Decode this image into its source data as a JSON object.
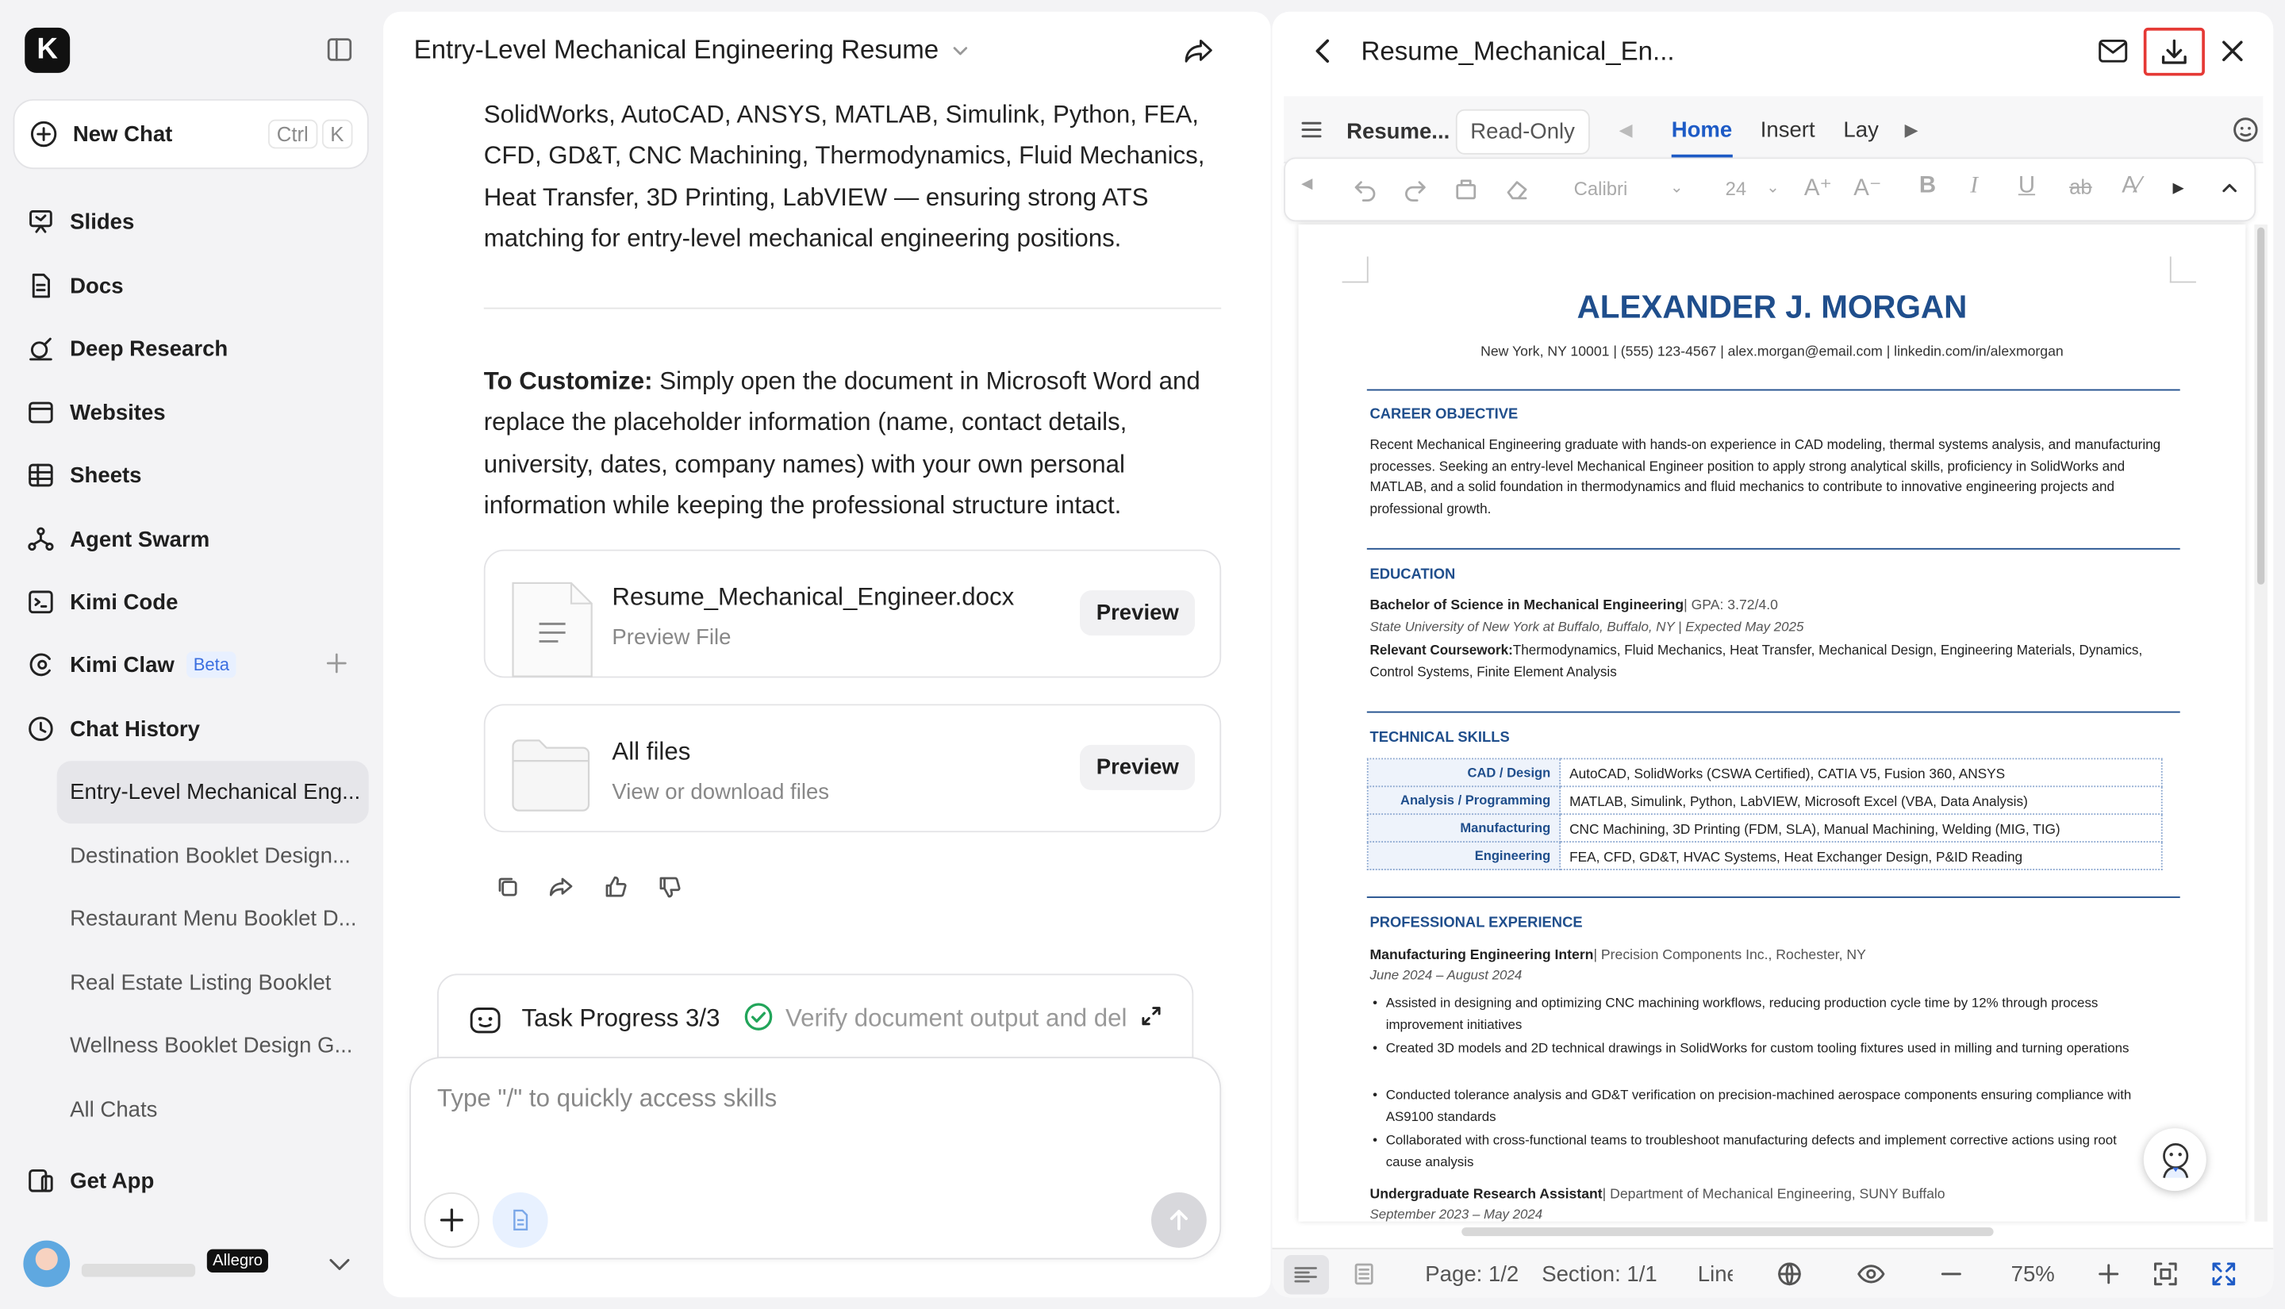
{
  "sidebar": {
    "logo": "K",
    "new_chat": {
      "label": "New Chat",
      "shortcut": [
        "Ctrl",
        "K"
      ]
    },
    "nav": [
      {
        "label": "Slides",
        "icon": "slides-icon"
      },
      {
        "label": "Docs",
        "icon": "docs-icon"
      },
      {
        "label": "Deep Research",
        "icon": "deep-research-icon"
      },
      {
        "label": "Websites",
        "icon": "websites-icon"
      },
      {
        "label": "Sheets",
        "icon": "sheets-icon"
      },
      {
        "label": "Agent Swarm",
        "icon": "agent-swarm-icon"
      },
      {
        "label": "Kimi Code",
        "icon": "kimi-code-icon"
      },
      {
        "label": "Kimi Claw",
        "icon": "kimi-claw-icon",
        "badge": "Beta"
      },
      {
        "label": "Chat History",
        "icon": "clock-icon"
      }
    ],
    "history": [
      "Entry-Level Mechanical Eng...",
      "Destination Booklet Design...",
      "Restaurant Menu Booklet D...",
      "Real Estate Listing Booklet",
      "Wellness Booklet Design G...",
      "All Chats"
    ],
    "get_app": "Get App",
    "user": {
      "tier": "Allegro"
    }
  },
  "chat": {
    "title": "Entry-Level Mechanical Engineering Resume",
    "paragraph1": "SolidWorks, AutoCAD, ANSYS, MATLAB, Simulink, Python, FEA, CFD, GD&T, CNC Machining, Thermodynamics, Fluid Mechanics, Heat Transfer, 3D Printing, LabVIEW — ensuring strong ATS matching for entry-level mechanical engineering positions.",
    "customize_bold": "To Customize:",
    "customize_text": " Simply open the document in Microsoft Word and replace the placeholder information (name, contact details, university, dates, company names) with your own personal information while keeping the professional structure intact.",
    "files": [
      {
        "name": "Resume_Mechanical_Engineer.docx",
        "sub": "Preview File",
        "button": "Preview"
      },
      {
        "name": "All files",
        "sub": "View or download files",
        "button": "Preview"
      }
    ],
    "task": {
      "label": "Task Progress 3/3",
      "status": "Verify document output and delivery"
    },
    "input_placeholder": "Type \"/\" to quickly access skills"
  },
  "preview": {
    "title": "Resume_Mechanical_En...",
    "doc_name": "Resume...",
    "mode": "Read-Only",
    "tabs": [
      "Home",
      "Insert",
      "Layo"
    ],
    "font": "Calibri",
    "font_size": "24",
    "status": {
      "page": "Page: 1/2",
      "section": "Section: 1/1",
      "line": "Line",
      "zoom": "75%"
    },
    "accent": "#1f4e8c",
    "highlight": "#e53935"
  },
  "resume": {
    "name": "ALEXANDER J. MORGAN",
    "contact": "New York, NY 10001  |  (555) 123-4567  |  alex.morgan@email.com  |  linkedin.com/in/alexmorgan",
    "objective_title": "CAREER OBJECTIVE",
    "objective": "Recent Mechanical Engineering graduate with hands-on experience in CAD modeling, thermal systems analysis, and manufacturing processes. Seeking an entry-level Mechanical Engineer position to apply strong analytical skills, proficiency in SolidWorks and MATLAB, and a solid foundation in thermodynamics and fluid mechanics to contribute to innovative engineering projects and professional growth.",
    "education_title": "EDUCATION",
    "degree": "Bachelor of Science in Mechanical Engineering",
    "gpa": "| GPA: 3.72/4.0",
    "school": "State University of New York at Buffalo, Buffalo, NY  |  Expected May 2025",
    "coursework_label": "Relevant Coursework:",
    "coursework": "Thermodynamics, Fluid Mechanics, Heat Transfer, Mechanical Design, Engineering Materials, Dynamics, Control Systems, Finite Element Analysis",
    "skills_title": "TECHNICAL SKILLS",
    "skills": [
      {
        "k": "CAD / Design",
        "v": "AutoCAD, SolidWorks (CSWA Certified), CATIA V5, Fusion 360, ANSYS"
      },
      {
        "k": "Analysis / Programming",
        "v": "MATLAB, Simulink, Python, LabVIEW, Microsoft Excel (VBA, Data Analysis)"
      },
      {
        "k": "Manufacturing",
        "v": "CNC Machining, 3D Printing (FDM, SLA), Manual Machining, Welding (MIG, TIG)"
      },
      {
        "k": "Engineering",
        "v": "FEA, CFD, GD&T, HVAC Systems, Heat Exchanger Design, P&ID Reading"
      }
    ],
    "experience_title": "PROFESSIONAL EXPERIENCE",
    "job1_title": "Manufacturing Engineering Intern",
    "job1_org": "|  Precision Components Inc., Rochester, NY",
    "job1_dates": "June 2024 – August 2024",
    "job1_bullets": [
      "Assisted in designing and optimizing CNC machining workflows, reducing production cycle time by 12% through process improvement initiatives",
      "Created 3D models and 2D technical drawings in SolidWorks for custom tooling fixtures used in milling and turning operations",
      "Conducted tolerance analysis and GD&T verification on precision-machined aerospace components ensuring compliance with AS9100 standards",
      "Collaborated with cross-functional teams to troubleshoot manufacturing defects and implement corrective actions using root cause analysis"
    ],
    "job2_title": "Undergraduate Research Assistant",
    "job2_org": "|  Department of Mechanical Engineering, SUNY Buffalo",
    "job2_dates": "September 2023 – May 2024"
  }
}
